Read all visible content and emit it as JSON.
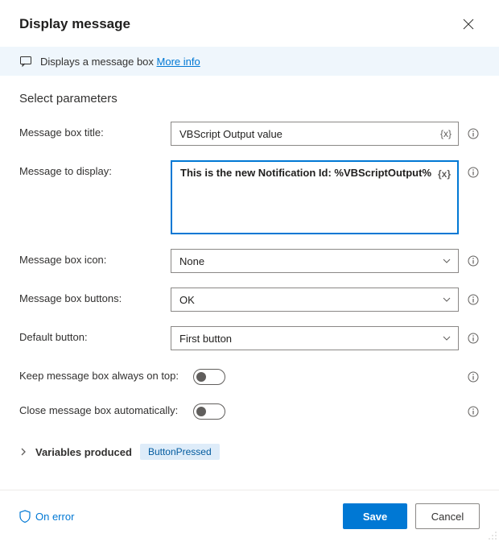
{
  "header": {
    "title": "Display message"
  },
  "banner": {
    "text": "Displays a message box",
    "link": "More info"
  },
  "section_title": "Select parameters",
  "fields": {
    "title_label": "Message box title:",
    "title_value": "VBScript Output value",
    "message_label": "Message to display:",
    "message_value": "This is the new Notification Id: %VBScriptOutput%",
    "icon_label": "Message box icon:",
    "icon_value": "None",
    "buttons_label": "Message box buttons:",
    "buttons_value": "OK",
    "default_label": "Default button:",
    "default_value": "First button",
    "ontop_label": "Keep message box always on top:",
    "autoclose_label": "Close message box automatically:"
  },
  "variables_produced": {
    "label": "Variables produced",
    "chip": "ButtonPressed"
  },
  "footer": {
    "on_error": "On error",
    "save": "Save",
    "cancel": "Cancel"
  },
  "glyphs": {
    "var": "{x}"
  }
}
